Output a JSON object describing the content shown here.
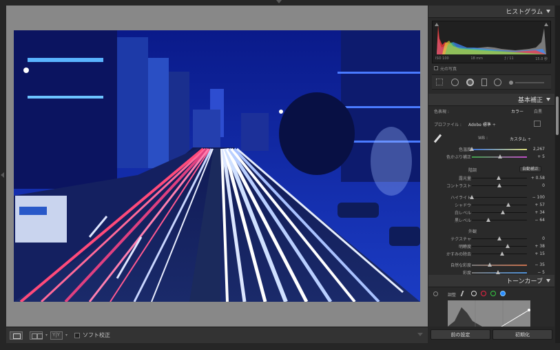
{
  "histogram": {
    "title": "ヒストグラム",
    "iso": "ISO 100",
    "focal": "18 mm",
    "aperture": "ƒ / 11",
    "shutter": "15.0 秒",
    "original_photo": "元の写真"
  },
  "basic": {
    "title": "基本補正",
    "treatment_label": "色表現 :",
    "treatment_color": "カラー",
    "treatment_bw": "白黒",
    "profile_label": "プロファイル :",
    "profile_value": "Adobe 標準 ÷",
    "wb_label": "WB :",
    "wb_value": "カスタム ÷",
    "temp_label": "色温度",
    "temp_value": "2,267",
    "tint_label": "色かぶり補正",
    "tint_value": "+ 5",
    "tone_label": "階調",
    "auto_label": "自動補正",
    "exposure_label": "露光量",
    "exposure_value": "+ 0.58",
    "contrast_label": "コントラスト",
    "contrast_value": "0",
    "highlights_label": "ハイライト",
    "highlights_value": "− 100",
    "shadows_label": "シャドウ",
    "shadows_value": "+ 57",
    "whites_label": "白レベル",
    "whites_value": "+ 34",
    "blacks_label": "黒レベル",
    "blacks_value": "− 64",
    "presence_label": "外観",
    "texture_label": "テクスチャ",
    "texture_value": "0",
    "clarity_label": "明瞭度",
    "clarity_value": "+ 38",
    "dehaze_label": "かすみの除去",
    "dehaze_value": "+ 15",
    "vibrance_label": "自然な彩度",
    "vibrance_value": "− 35",
    "saturation_label": "彩度",
    "saturation_value": "− 5"
  },
  "tone_curve": {
    "title": "トーンカーブ",
    "adjust_label": "調整"
  },
  "toolbar": {
    "soft_proof": "ソフト校正"
  },
  "buttons": {
    "previous": "前の設定",
    "reset": "初期化"
  }
}
